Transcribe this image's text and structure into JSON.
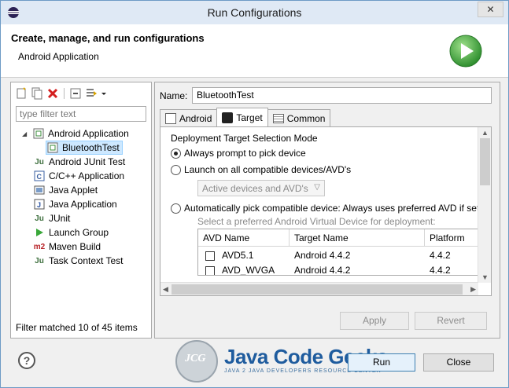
{
  "window": {
    "title": "Run Configurations",
    "close_glyph": "✕"
  },
  "banner": {
    "title": "Create, manage, and run configurations",
    "subtitle": "Android Application"
  },
  "left": {
    "filter_placeholder": "type filter text",
    "tree": [
      {
        "label": "Android Application",
        "icon": "android-app-icon",
        "expanded": true
      },
      {
        "label": "BluetoothTest",
        "icon": "android-config-icon",
        "selected": true
      },
      {
        "label": "Android JUnit Test",
        "icon": "junit-icon"
      },
      {
        "label": "C/C++ Application",
        "icon": "c-app-icon"
      },
      {
        "label": "Java Applet",
        "icon": "applet-icon"
      },
      {
        "label": "Java Application",
        "icon": "java-app-icon"
      },
      {
        "label": "JUnit",
        "icon": "junit-icon"
      },
      {
        "label": "Launch Group",
        "icon": "launch-group-icon"
      },
      {
        "label": "Maven Build",
        "icon": "maven-icon"
      },
      {
        "label": "Task Context Test",
        "icon": "task-context-icon"
      }
    ],
    "status": "Filter matched 10 of 45 items",
    "junit_glyph": "Ju",
    "maven_glyph": "m2"
  },
  "right": {
    "name_label": "Name:",
    "name_value": "BluetoothTest",
    "tabs": [
      {
        "label": "Android",
        "active": false
      },
      {
        "label": "Target",
        "active": true
      },
      {
        "label": "Common",
        "active": false
      }
    ],
    "section_title": "Deployment Target Selection Mode",
    "radio_always": "Always prompt to pick device",
    "radio_launch_all": "Launch on all compatible devices/AVD's",
    "dropdown_value": "Active devices and AVD's",
    "radio_auto": "Automatically pick compatible device: Always uses preferred AVD if set",
    "hint": "Select a preferred Android Virtual Device for deployment:",
    "avd_columns": [
      "AVD Name",
      "Target Name",
      "Platform"
    ],
    "avd_rows": [
      {
        "name": "AVD5.1",
        "target": "Android 4.4.2",
        "platform": "4.4.2"
      },
      {
        "name": "AVD_WVGA",
        "target": "Android 4.4.2",
        "platform": "4.4.2"
      }
    ],
    "apply_label": "Apply",
    "revert_label": "Revert"
  },
  "footer": {
    "run_label": "Run",
    "close_label": "Close",
    "help_glyph": "?"
  },
  "watermark": {
    "logo": "JCG",
    "name": "Java Code Geeks",
    "tagline": "JAVA 2 JAVA DEVELOPERS RESOURCE CENTER"
  },
  "colors": {
    "accent": "#3399ff",
    "play_green": "#3aa83a",
    "selection": "#cde8ff"
  }
}
